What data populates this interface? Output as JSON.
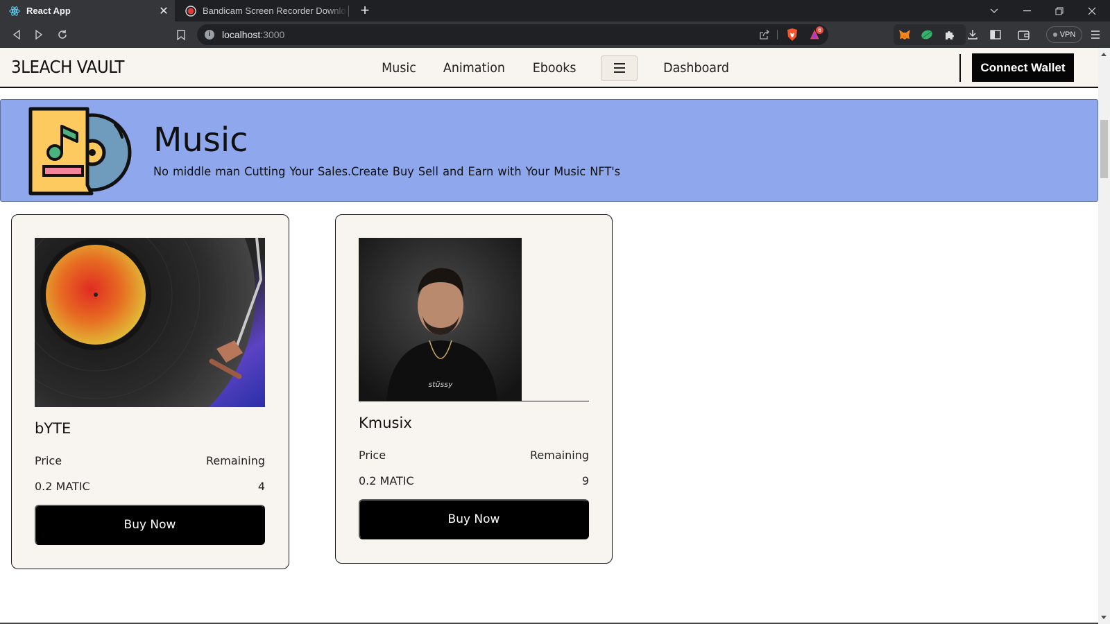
{
  "browser": {
    "tabs": [
      {
        "title": "React App",
        "icon": "react-icon",
        "active": true
      },
      {
        "title": "Bandicam Screen Recorder Download",
        "icon": "bandicam-icon",
        "active": false
      }
    ],
    "url_host": "localhost",
    "url_port": ":3000",
    "vpn_label": "VPN",
    "brave_badge": "6"
  },
  "navbar": {
    "brand": "3LEACH VAULT",
    "links": [
      "Music",
      "Animation",
      "Ebooks"
    ],
    "dashboard": "Dashboard",
    "connect_label": "Connect Wallet"
  },
  "banner": {
    "title": "Music",
    "subtitle": "No middle man Cutting Your Sales.Create  Buy Sell and  Earn with Your  Music  NFT's",
    "colors": {
      "background": "#8fa7ec",
      "icon_yellow": "#fcca5f",
      "icon_green": "#4bb37f",
      "icon_pink": "#f3849b",
      "disc": "#6f9bbd"
    }
  },
  "cards": [
    {
      "name": "bYTE",
      "price_label": "Price",
      "remaining_label": "Remaining",
      "price": "0.2 MATIC",
      "remaining": "4",
      "buy_label": "Buy Now",
      "image": "vinyl-turntable-image"
    },
    {
      "name": "Kmusix",
      "price_label": "Price",
      "remaining_label": "Remaining",
      "price": "0.2 MATIC",
      "remaining": "9",
      "buy_label": "Buy Now",
      "image": "artist-portrait-image",
      "shirt_text": "stüssy"
    }
  ]
}
